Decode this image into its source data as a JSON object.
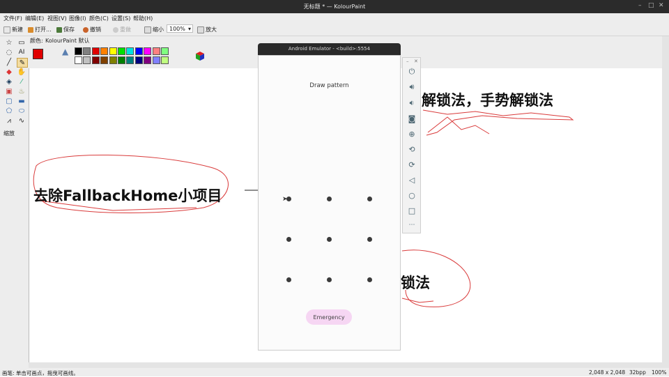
{
  "window": {
    "title": "无标题 * — KolourPaint"
  },
  "menu": [
    "文件(F)",
    "编辑(E)",
    "视图(V)",
    "图像(I)",
    "颜色(C)",
    "设置(S)",
    "帮助(H)"
  ],
  "toolbar": {
    "new": "新建",
    "open": "打开...",
    "save": "保存",
    "undo": "撤销",
    "redo": "重做",
    "zoom_out": "缩小",
    "zoom_value": "100%",
    "zoom_in": "放大"
  },
  "tools": {
    "zoom_label": "缩放"
  },
  "colors": {
    "label": "颜色:",
    "scheme": "KolourPaint 默认",
    "foreground": "#e00000",
    "row1": [
      "#000000",
      "#808080",
      "#e00000",
      "#ff8000",
      "#ffff00",
      "#00e000",
      "#00e0e0",
      "#0000ff",
      "#ff00ff",
      "#ff8080",
      "#80ff80"
    ],
    "row2": [
      "#ffffff",
      "#c0c0c0",
      "#800000",
      "#804000",
      "#808000",
      "#008000",
      "#008080",
      "#000080",
      "#800080",
      "#8080ff",
      "#c0ff80"
    ]
  },
  "canvas_text": {
    "line1": "解锁法，手势解锁法",
    "line2": "去除FallbackHome小项目",
    "line3": "锁法"
  },
  "emulator": {
    "title": "Android Emulator - <build>:5554",
    "heading": "Draw pattern",
    "emergency": "Emergency",
    "side_icons": [
      "power-icon",
      "volume-up-icon",
      "volume-down-icon",
      "camera-icon",
      "zoom-icon",
      "rotate-left-icon",
      "rotate-right-icon",
      "back-icon",
      "home-icon",
      "overview-icon",
      "more-icon"
    ]
  },
  "status": {
    "hint": "画笔: 单击可画点，拖曳可画线。",
    "size": "2,048 x 2,048",
    "depth": "32bpp",
    "zoom": "100%"
  }
}
